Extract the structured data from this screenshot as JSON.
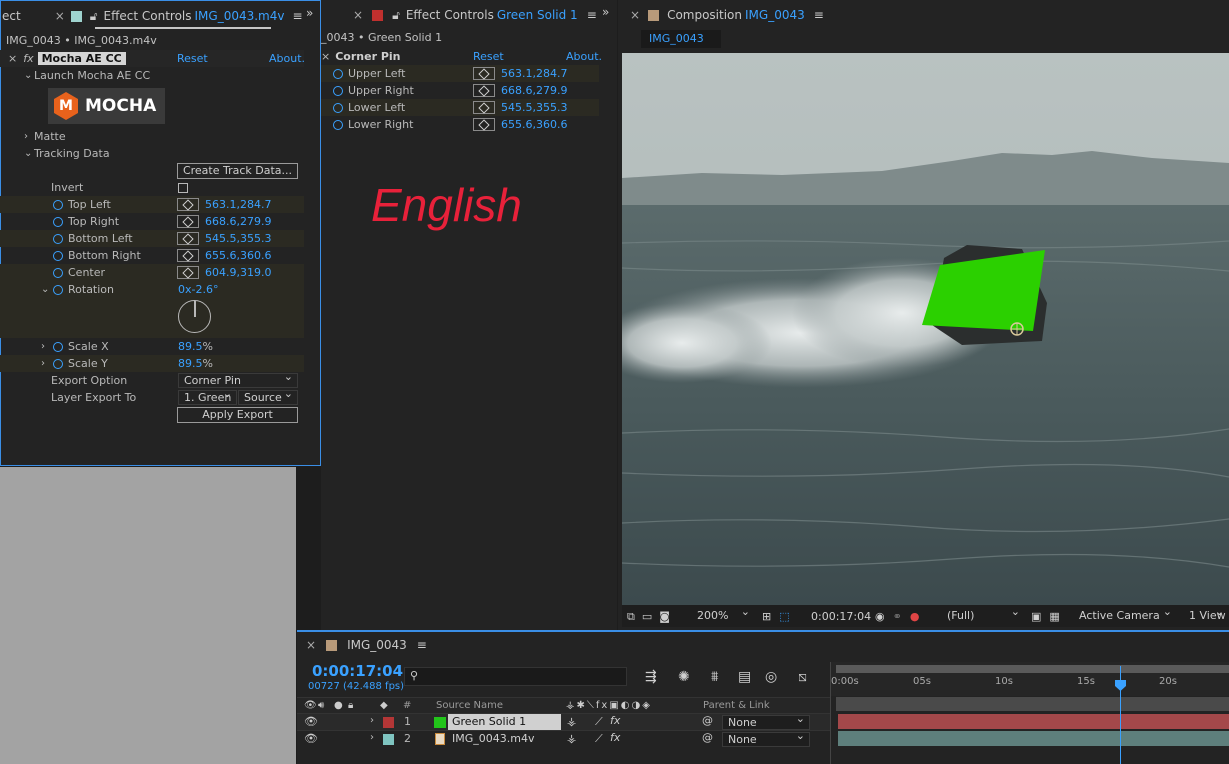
{
  "panel1": {
    "tab_prefix": "ect",
    "tab_label": "Effect Controls ",
    "tab_file": "IMG_0043.m4v",
    "breadcrumb": "IMG_0043 • IMG_0043.m4v",
    "effect_name": "Mocha AE CC",
    "reset": "Reset",
    "about": "About.",
    "launch": "Launch Mocha AE CC",
    "logo_letter": "M",
    "logo_text": "MOCHA",
    "matte": "Matte",
    "tracking_data": "Tracking Data",
    "create_track": "Create Track Data...",
    "invert": "Invert",
    "params": [
      {
        "label": "Top Left",
        "value": "563.1,284.7"
      },
      {
        "label": "Top Right",
        "value": "668.6,279.9"
      },
      {
        "label": "Bottom Left",
        "value": "545.5,355.3"
      },
      {
        "label": "Bottom Right",
        "value": "655.6,360.6"
      },
      {
        "label": "Center",
        "value": "604.9,319.0"
      }
    ],
    "rotation_label": "Rotation",
    "rotation_value": "0x-2.6°",
    "scale_x_label": "Scale X",
    "scale_x_value": "89.5",
    "scale_y_label": "Scale Y",
    "scale_y_value": "89.5",
    "percent": "%",
    "export_option_label": "Export Option",
    "export_option_value": "Corner Pin",
    "layer_export_label": "Layer Export To",
    "layer_export_value": "1. Green",
    "layer_source_value": "Source",
    "apply_export": "Apply Export"
  },
  "panel2": {
    "tab_label": "Effect Controls ",
    "tab_file": "Green Solid 1",
    "breadcrumb": "_0043 • Green Solid 1",
    "effect_name": "Corner Pin",
    "reset": "Reset",
    "about": "About.",
    "params": [
      {
        "label": "Upper Left",
        "value": "563.1,284.7"
      },
      {
        "label": "Upper Right",
        "value": "668.6,279.9"
      },
      {
        "label": "Lower Left",
        "value": "545.5,355.3"
      },
      {
        "label": "Lower Right",
        "value": "655.6,360.6"
      }
    ],
    "overlay_text": "English"
  },
  "composition": {
    "tab_label": "Composition ",
    "tab_name": "IMG_0043",
    "subtab": "IMG_0043",
    "zoom": "200%",
    "timecode": "0:00:17:04",
    "resolution": "(Full)",
    "camera": "Active Camera",
    "views": "1 View"
  },
  "timeline": {
    "tab": "IMG_0043",
    "timecode": "0:00:17:04",
    "frames": "00727 (42.488 fps)",
    "search_placeholder": "",
    "col_hash": "#",
    "col_source": "Source Name",
    "col_parent": "Parent & Link",
    "ruler": [
      "0:00s",
      "05s",
      "10s",
      "15s",
      "20s"
    ],
    "layers": [
      {
        "num": "1",
        "name": "Green Solid 1",
        "parent": "None",
        "color": "#b33636",
        "swatch": "#22c41a"
      },
      {
        "num": "2",
        "name": "IMG_0043.m4v",
        "parent": "None",
        "color": "#7fc4c0",
        "swatch": "#c98a3c"
      }
    ]
  },
  "colors": {
    "accent": "#3aa1ff",
    "green_solid": "#2bd000",
    "overlay": "#e8213a"
  }
}
